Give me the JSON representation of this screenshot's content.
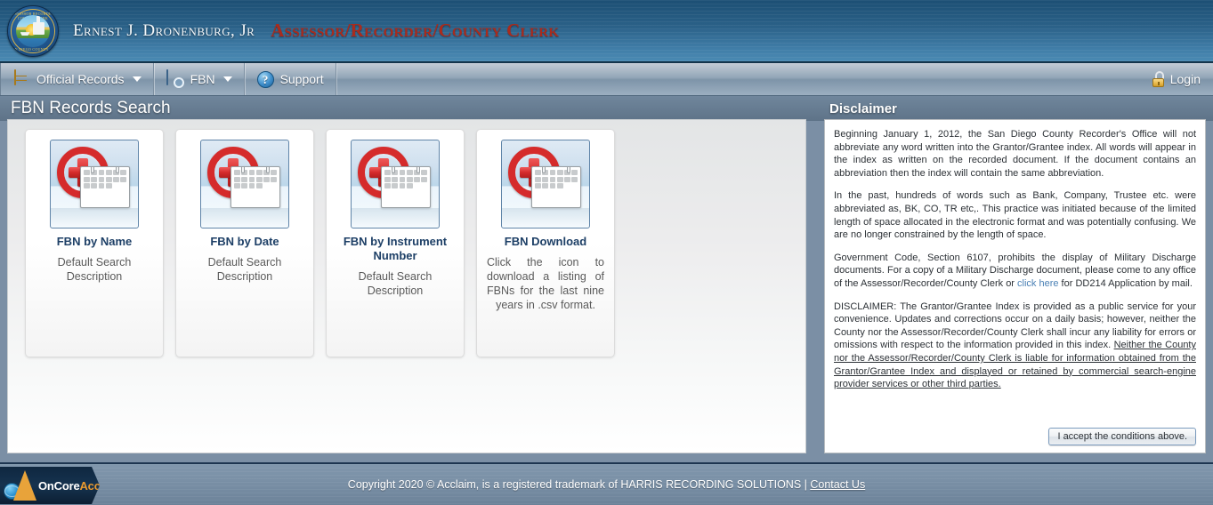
{
  "header": {
    "seal_text_top": "ASSESSOR RECORDER COUNTY CLERK",
    "seal_text_bottom": "SAN DIEGO COUNTY, CA",
    "official_name": "Ernest J. Dronenburg, Jr",
    "office_role": "Assessor/Recorder/County Clerk"
  },
  "nav": {
    "items": [
      {
        "label": "Official Records",
        "icon": "file-cabinet-icon",
        "has_caret": true
      },
      {
        "label": "FBN",
        "icon": "fbn-search-icon",
        "has_caret": true
      },
      {
        "label": "Support",
        "icon": "help-circle-icon",
        "has_caret": false
      }
    ],
    "login_label": "Login",
    "login_icon": "padlock-icon"
  },
  "main": {
    "section_title": "FBN Records Search",
    "cards": [
      {
        "title": "FBN by Name",
        "description": "Default Search Description",
        "icon": "calendar-plus-icon"
      },
      {
        "title": "FBN by Date",
        "description": "Default Search Description",
        "icon": "calendar-plus-icon"
      },
      {
        "title": "FBN by Instrument Number",
        "description": "Default Search Description",
        "icon": "calendar-plus-icon"
      },
      {
        "title": "FBN Download",
        "description": "Click the icon to download a listing of FBNs for the last nine years in .csv format.",
        "icon": "calendar-plus-icon"
      }
    ]
  },
  "disclaimer": {
    "title": "Disclaimer",
    "paragraph_1": "Beginning January 1, 2012, the San Diego County Recorder's Office will not abbreviate any word written into the Grantor/Grantee index. All words will appear in the index as written on the recorded document. If the document contains an abbreviation then the index will contain the same abbreviation.",
    "paragraph_2": "In the past, hundreds of words such as Bank, Company, Trustee etc. were abbreviated as, BK, CO, TR etc,. This practice was initiated because of the limited length of space allocated in the electronic format and was potentially confusing. We are no longer constrained by the length of space.",
    "paragraph_3_part_1": "Government Code, Section 6107, prohibits the display of Military Discharge documents. For a copy of a Military Discharge document, please come to any office of the Assessor/Recorder/County Clerk or ",
    "paragraph_3_link": "click here",
    "paragraph_3_part_2": " for DD214 Application by mail.",
    "paragraph_4_part_1": "DISCLAIMER: The Grantor/Grantee Index is provided as a public service for your convenience. Updates and corrections occur on a daily basis; however, neither the County nor the Assessor/Recorder/County Clerk shall incur any liability for errors or omissions with respect to the information provided in this index. ",
    "paragraph_4_underlined": "Neither the County nor the Assessor/Recorder/County Clerk is liable for information obtained from the Grantor/Grantee Index and displayed or retained by commercial search-engine provider services or other third parties.",
    "accept_button_label": "I accept the conditions above."
  },
  "footer": {
    "brand_primary": "OnCore",
    "brand_secondary": "Acclaim",
    "copyright_text": "Copyright 2020 © Acclaim, is a registered trademark of HARRIS RECORDING SOLUTIONS | ",
    "contact_link": "Contact Us"
  },
  "colors": {
    "header_blue": "#2a6087",
    "role_red": "#a92b1d",
    "page_background": "#7b8fa5",
    "card_title_blue": "#1d3f66",
    "icon_red": "#d52b2b",
    "icon_orange": "#ef8c1f",
    "brand_orange": "#ea9a2e"
  }
}
